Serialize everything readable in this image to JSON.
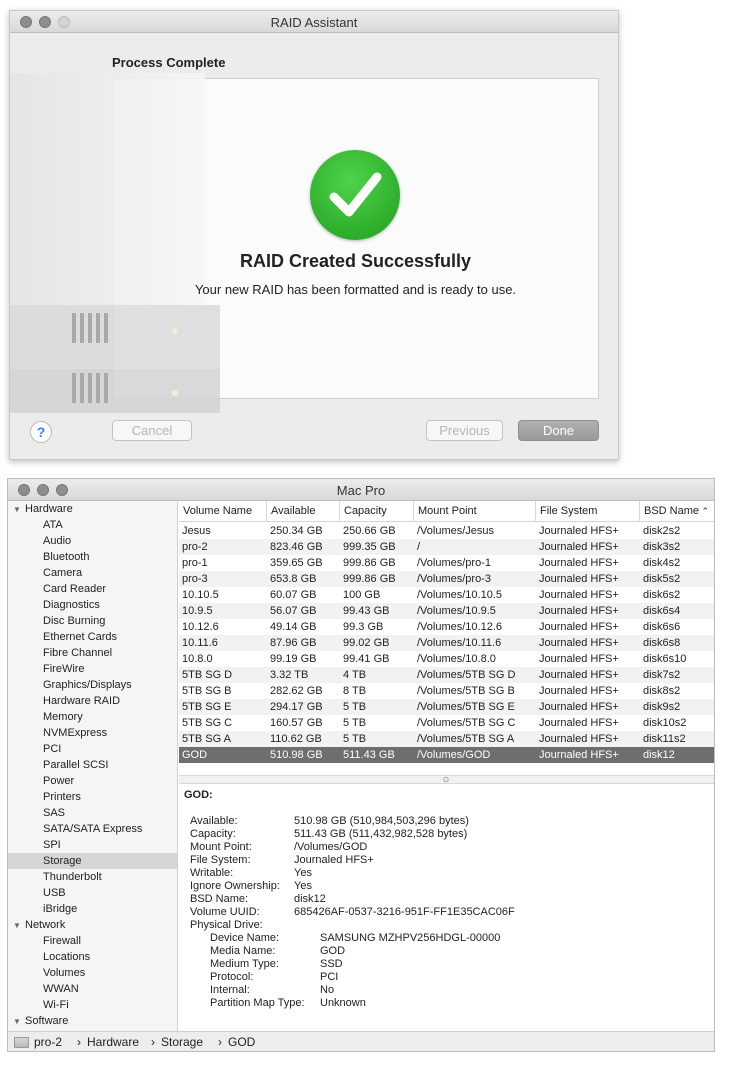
{
  "raid": {
    "title": "RAID Assistant",
    "heading": "Process Complete",
    "success_title": "RAID Created Successfully",
    "success_sub": "Your new RAID has been formatted and is ready to use.",
    "help_label": "?",
    "cancel_label": "Cancel",
    "previous_label": "Previous",
    "done_label": "Done",
    "success_color": "#2fb52b"
  },
  "mac": {
    "title": "Mac Pro",
    "sidebar": [
      {
        "label": "Hardware",
        "level": 0,
        "expanded": true
      },
      {
        "label": "ATA",
        "level": 1
      },
      {
        "label": "Audio",
        "level": 1
      },
      {
        "label": "Bluetooth",
        "level": 1
      },
      {
        "label": "Camera",
        "level": 1
      },
      {
        "label": "Card Reader",
        "level": 1
      },
      {
        "label": "Diagnostics",
        "level": 1
      },
      {
        "label": "Disc Burning",
        "level": 1
      },
      {
        "label": "Ethernet Cards",
        "level": 1
      },
      {
        "label": "Fibre Channel",
        "level": 1
      },
      {
        "label": "FireWire",
        "level": 1
      },
      {
        "label": "Graphics/Displays",
        "level": 1
      },
      {
        "label": "Hardware RAID",
        "level": 1
      },
      {
        "label": "Memory",
        "level": 1
      },
      {
        "label": "NVMExpress",
        "level": 1
      },
      {
        "label": "PCI",
        "level": 1
      },
      {
        "label": "Parallel SCSI",
        "level": 1
      },
      {
        "label": "Power",
        "level": 1
      },
      {
        "label": "Printers",
        "level": 1
      },
      {
        "label": "SAS",
        "level": 1
      },
      {
        "label": "SATA/SATA Express",
        "level": 1
      },
      {
        "label": "SPI",
        "level": 1
      },
      {
        "label": "Storage",
        "level": 1,
        "selected": true
      },
      {
        "label": "Thunderbolt",
        "level": 1
      },
      {
        "label": "USB",
        "level": 1
      },
      {
        "label": "iBridge",
        "level": 1
      },
      {
        "label": "Network",
        "level": 0,
        "expanded": true
      },
      {
        "label": "Firewall",
        "level": 1
      },
      {
        "label": "Locations",
        "level": 1
      },
      {
        "label": "Volumes",
        "level": 1
      },
      {
        "label": "WWAN",
        "level": 1
      },
      {
        "label": "Wi-Fi",
        "level": 1
      },
      {
        "label": "Software",
        "level": 0,
        "expanded": true
      }
    ],
    "columns": [
      "Volume Name",
      "Available",
      "Capacity",
      "Mount Point",
      "File System",
      "BSD Name"
    ],
    "sort_indicator": "⌃",
    "rows": [
      [
        "Jesus",
        "250.34 GB",
        "250.66 GB",
        "/Volumes/Jesus",
        "Journaled HFS+",
        "disk2s2"
      ],
      [
        "pro-2",
        "823.46 GB",
        "999.35 GB",
        "/",
        "Journaled HFS+",
        "disk3s2"
      ],
      [
        "pro-1",
        "359.65 GB",
        "999.86 GB",
        "/Volumes/pro-1",
        "Journaled HFS+",
        "disk4s2"
      ],
      [
        "pro-3",
        "653.8 GB",
        "999.86 GB",
        "/Volumes/pro-3",
        "Journaled HFS+",
        "disk5s2"
      ],
      [
        "10.10.5",
        "60.07 GB",
        "100 GB",
        "/Volumes/10.10.5",
        "Journaled HFS+",
        "disk6s2"
      ],
      [
        "10.9.5",
        "56.07 GB",
        "99.43 GB",
        "/Volumes/10.9.5",
        "Journaled HFS+",
        "disk6s4"
      ],
      [
        "10.12.6",
        "49.14 GB",
        "99.3 GB",
        "/Volumes/10.12.6",
        "Journaled HFS+",
        "disk6s6"
      ],
      [
        "10.11.6",
        "87.96 GB",
        "99.02 GB",
        "/Volumes/10.11.6",
        "Journaled HFS+",
        "disk6s8"
      ],
      [
        "10.8.0",
        "99.19 GB",
        "99.41 GB",
        "/Volumes/10.8.0",
        "Journaled HFS+",
        "disk6s10"
      ],
      [
        "5TB SG D",
        "3.32 TB",
        "4 TB",
        "/Volumes/5TB SG D",
        "Journaled HFS+",
        "disk7s2"
      ],
      [
        "5TB SG B",
        "282.62 GB",
        "8 TB",
        "/Volumes/5TB SG B",
        "Journaled HFS+",
        "disk8s2"
      ],
      [
        "5TB SG E",
        "294.17 GB",
        "5 TB",
        "/Volumes/5TB SG E",
        "Journaled HFS+",
        "disk9s2"
      ],
      [
        "5TB SG C",
        "160.57 GB",
        "5 TB",
        "/Volumes/5TB SG C",
        "Journaled HFS+",
        "disk10s2"
      ],
      [
        "5TB SG A",
        "110.62 GB",
        "5 TB",
        "/Volumes/5TB SG A",
        "Journaled HFS+",
        "disk11s2"
      ],
      [
        "GOD",
        "510.98 GB",
        "511.43 GB",
        "/Volumes/GOD",
        "Journaled HFS+",
        "disk12"
      ]
    ],
    "selected_row": 14,
    "detail": {
      "heading": "GOD:",
      "fields": [
        [
          "Available:",
          "510.98 GB (510,984,503,296 bytes)"
        ],
        [
          "Capacity:",
          "511.43 GB (511,432,982,528 bytes)"
        ],
        [
          "Mount Point:",
          "/Volumes/GOD"
        ],
        [
          "File System:",
          "Journaled HFS+"
        ],
        [
          "Writable:",
          "Yes"
        ],
        [
          "Ignore Ownership:",
          "Yes"
        ],
        [
          "BSD Name:",
          "disk12"
        ],
        [
          "Volume UUID:",
          "685426AF-0537-3216-951F-FF1E35CAC06F"
        ],
        [
          "Physical Drive:",
          ""
        ]
      ],
      "physical": [
        [
          "Device Name:",
          "SAMSUNG MZHPV256HDGL-00000"
        ],
        [
          "Media Name:",
          "GOD"
        ],
        [
          "Medium Type:",
          "SSD"
        ],
        [
          "Protocol:",
          "PCI"
        ],
        [
          "Internal:",
          "No"
        ],
        [
          "Partition Map Type:",
          "Unknown"
        ]
      ]
    },
    "path": [
      "pro-2",
      "Hardware",
      "Storage",
      "GOD"
    ]
  }
}
